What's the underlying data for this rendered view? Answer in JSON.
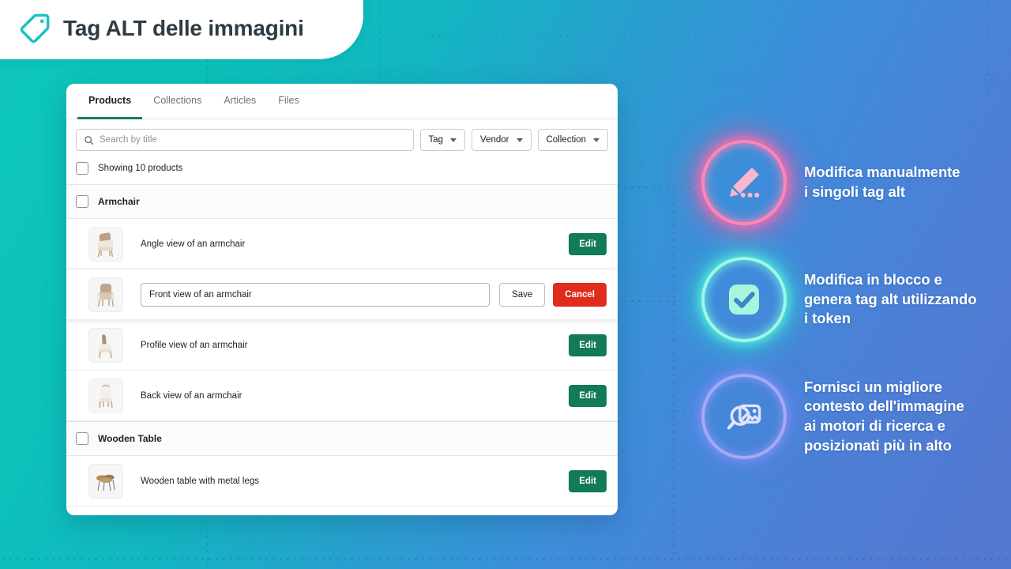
{
  "header": {
    "title": "Tag ALT delle immagini",
    "icon": "tag-icon"
  },
  "colors": {
    "accent_teal": "#0ec7bb",
    "accent_blue": "#4d7fd6",
    "edit_green": "#127a58",
    "cancel_red": "#e02b1d",
    "tab_active_underline": "#108060",
    "glow_pink": "#ff85b5",
    "glow_teal": "#9cf9e2",
    "glow_blue": "#a8a8f5"
  },
  "app": {
    "tabs": [
      {
        "label": "Products",
        "active": true
      },
      {
        "label": "Collections",
        "active": false
      },
      {
        "label": "Articles",
        "active": false
      },
      {
        "label": "Files",
        "active": false
      }
    ],
    "search": {
      "placeholder": "Search by title",
      "value": "",
      "icon": "search-icon"
    },
    "filters": [
      {
        "label": "Tag",
        "icon": "chevron-down-icon"
      },
      {
        "label": "Vendor",
        "icon": "chevron-down-icon"
      },
      {
        "label": "Collection",
        "icon": "chevron-down-icon"
      }
    ],
    "showing_text": "Showing 10 products",
    "groups": [
      {
        "title": "Armchair",
        "rows": [
          {
            "alt_text": "Angle view of an armchair",
            "editing": false,
            "action_label": "Edit",
            "thumb": "armchair-angle-thumb"
          },
          {
            "alt_text": "Front view of an armchair",
            "editing": true,
            "save_label": "Save",
            "cancel_label": "Cancel",
            "thumb": "armchair-front-thumb"
          },
          {
            "alt_text": "Profile view of an armchair",
            "editing": false,
            "action_label": "Edit",
            "thumb": "armchair-profile-thumb"
          },
          {
            "alt_text": "Back view of an armchair",
            "editing": false,
            "action_label": "Edit",
            "thumb": "armchair-back-thumb"
          }
        ]
      },
      {
        "title": "Wooden Table",
        "rows": [
          {
            "alt_text": "Wooden table with metal legs",
            "editing": false,
            "action_label": "Edit",
            "thumb": "wooden-table-thumb"
          }
        ]
      }
    ]
  },
  "features": [
    {
      "text": "Modifica manualmente\ni singoli tag alt",
      "icon": "pencil-dots-icon",
      "accent": "#ff85b5"
    },
    {
      "text": "Modifica in blocco e\ngenera tag alt utilizzando\ni token",
      "icon": "checkbox-check-icon",
      "accent": "#9cf9e2"
    },
    {
      "text": "Fornisci un migliore\ncontesto dell'immagine\nai motori di ricerca e\nposizionati più in alto",
      "icon": "image-search-icon",
      "accent": "#a8a8f5"
    }
  ]
}
